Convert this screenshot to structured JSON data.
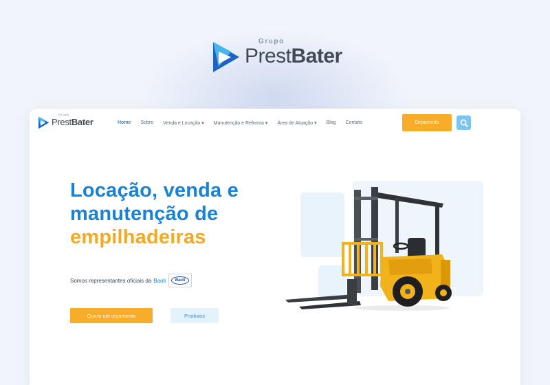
{
  "brand": {
    "group_label": "Grupo",
    "name_light": "Prest",
    "name_bold": "Bater"
  },
  "nav": {
    "items": [
      {
        "label": "Home"
      },
      {
        "label": "Sobre"
      },
      {
        "label": "Venda e Locação ▾"
      },
      {
        "label": "Manutenção e Reforma ▾"
      },
      {
        "label": "Área de Atuação ▾"
      },
      {
        "label": "Blog"
      },
      {
        "label": "Contato"
      }
    ],
    "cta_label": "Orçamento"
  },
  "hero": {
    "title_line1": "Locação, venda e",
    "title_line2": "manutenção de",
    "title_line3": "empilhadeiras",
    "rep_text": "Somos representantes oficiais da",
    "rep_brand": "Baoli",
    "partner_logo_text": "Baoli",
    "primary_cta": "Quero um orçamento",
    "secondary_cta": "Produtos"
  },
  "colors": {
    "accent_blue": "#1683d6",
    "accent_orange": "#f7ad29",
    "search_blue": "#7cc5ef",
    "forklift_yellow": "#f2b21a"
  },
  "icons": {
    "logo": "prestbater-play-logo-icon",
    "search": "search-icon",
    "forklift": "forklift-image"
  }
}
